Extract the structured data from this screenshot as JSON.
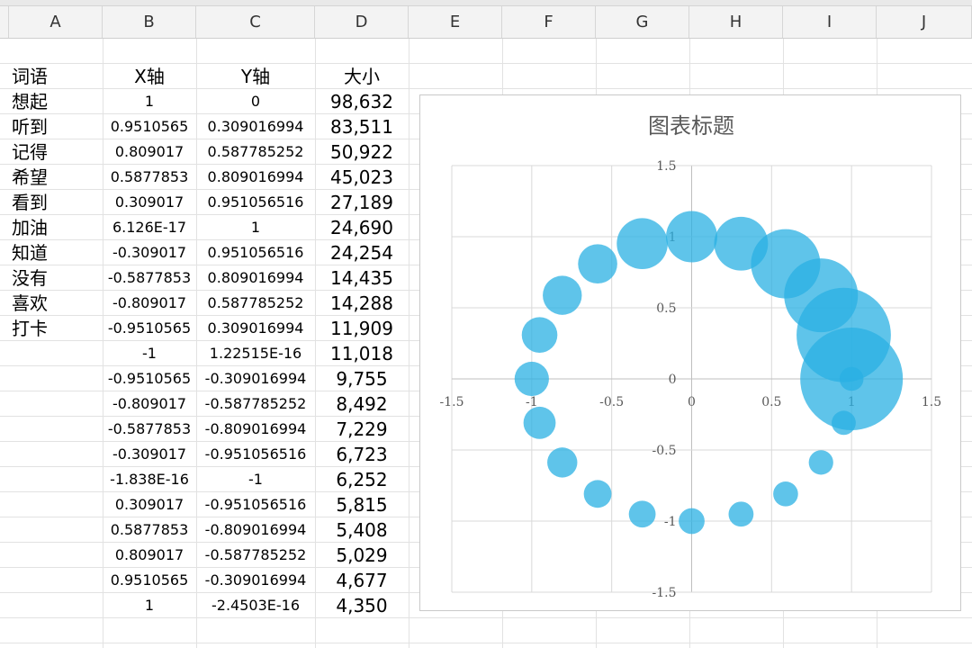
{
  "columns": [
    "A",
    "B",
    "C",
    "D",
    "E",
    "F",
    "G",
    "H",
    "I",
    "J"
  ],
  "table": {
    "headers": {
      "word": "词语",
      "x": "X轴",
      "y": "Y轴",
      "size": "大小"
    },
    "rows": [
      {
        "word": "想起",
        "x": "1",
        "y": "0",
        "size": "98,632"
      },
      {
        "word": "听到",
        "x": "0.9510565",
        "y": "0.309016994",
        "size": "83,511"
      },
      {
        "word": "记得",
        "x": "0.809017",
        "y": "0.587785252",
        "size": "50,922"
      },
      {
        "word": "希望",
        "x": "0.5877853",
        "y": "0.809016994",
        "size": "45,023"
      },
      {
        "word": "看到",
        "x": "0.309017",
        "y": "0.951056516",
        "size": "27,189"
      },
      {
        "word": "加油",
        "x": "6.126E-17",
        "y": "1",
        "size": "24,690"
      },
      {
        "word": "知道",
        "x": "-0.309017",
        "y": "0.951056516",
        "size": "24,254"
      },
      {
        "word": "没有",
        "x": "-0.5877853",
        "y": "0.809016994",
        "size": "14,435"
      },
      {
        "word": "喜欢",
        "x": "-0.809017",
        "y": "0.587785252",
        "size": "14,288"
      },
      {
        "word": "打卡",
        "x": "-0.9510565",
        "y": "0.309016994",
        "size": "11,909"
      },
      {
        "word": "",
        "x": "-1",
        "y": "1.22515E-16",
        "size": "11,018"
      },
      {
        "word": "",
        "x": "-0.9510565",
        "y": "-0.309016994",
        "size": "9,755"
      },
      {
        "word": "",
        "x": "-0.809017",
        "y": "-0.587785252",
        "size": "8,492"
      },
      {
        "word": "",
        "x": "-0.5877853",
        "y": "-0.809016994",
        "size": "7,229"
      },
      {
        "word": "",
        "x": "-0.309017",
        "y": "-0.951056516",
        "size": "6,723"
      },
      {
        "word": "",
        "x": "-1.838E-16",
        "y": "-1",
        "size": "6,252"
      },
      {
        "word": "",
        "x": "0.309017",
        "y": "-0.951056516",
        "size": "5,815"
      },
      {
        "word": "",
        "x": "0.5877853",
        "y": "-0.809016994",
        "size": "5,408"
      },
      {
        "word": "",
        "x": "0.809017",
        "y": "-0.587785252",
        "size": "5,029"
      },
      {
        "word": "",
        "x": "0.9510565",
        "y": "-0.309016994",
        "size": "4,677"
      },
      {
        "word": "",
        "x": "1",
        "y": "-2.4503E-16",
        "size": "4,350"
      }
    ]
  },
  "chart_data": {
    "type": "scatter",
    "bubble": true,
    "title": "图表标题",
    "xlabel": "",
    "ylabel": "",
    "xlim": [
      -1.5,
      1.5
    ],
    "ylim": [
      -1.5,
      1.5
    ],
    "x_ticks": [
      "-1.5",
      "-1",
      "-0.5",
      "0",
      "0.5",
      "1",
      "1.5"
    ],
    "y_ticks": [
      "1.5",
      "1",
      "0.5",
      "0",
      "-0.5",
      "-1",
      "-1.5"
    ],
    "grid": true,
    "color": "#29b0e3",
    "points": [
      {
        "x": 1,
        "y": 0,
        "size": 98632
      },
      {
        "x": 0.9510565,
        "y": 0.309016994,
        "size": 83511
      },
      {
        "x": 0.809017,
        "y": 0.587785252,
        "size": 50922
      },
      {
        "x": 0.5877853,
        "y": 0.809016994,
        "size": 45023
      },
      {
        "x": 0.309017,
        "y": 0.951056516,
        "size": 27189
      },
      {
        "x": 0,
        "y": 1,
        "size": 24690
      },
      {
        "x": -0.309017,
        "y": 0.951056516,
        "size": 24254
      },
      {
        "x": -0.5877853,
        "y": 0.809016994,
        "size": 14435
      },
      {
        "x": -0.809017,
        "y": 0.587785252,
        "size": 14288
      },
      {
        "x": -0.9510565,
        "y": 0.309016994,
        "size": 11909
      },
      {
        "x": -1,
        "y": 0,
        "size": 11018
      },
      {
        "x": -0.9510565,
        "y": -0.309016994,
        "size": 9755
      },
      {
        "x": -0.809017,
        "y": -0.587785252,
        "size": 8492
      },
      {
        "x": -0.5877853,
        "y": -0.809016994,
        "size": 7229
      },
      {
        "x": -0.309017,
        "y": -0.951056516,
        "size": 6723
      },
      {
        "x": 0,
        "y": -1,
        "size": 6252
      },
      {
        "x": 0.309017,
        "y": -0.951056516,
        "size": 5815
      },
      {
        "x": 0.5877853,
        "y": -0.809016994,
        "size": 5408
      },
      {
        "x": 0.809017,
        "y": -0.587785252,
        "size": 5029
      },
      {
        "x": 0.9510565,
        "y": -0.309016994,
        "size": 4677
      },
      {
        "x": 1,
        "y": 0,
        "size": 4350
      }
    ]
  }
}
